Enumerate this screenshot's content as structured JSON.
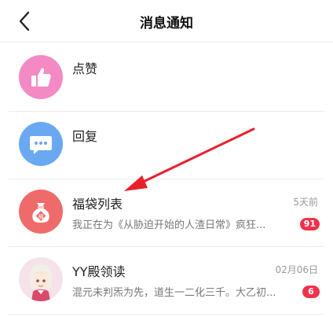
{
  "header": {
    "title": "消息通知",
    "back_icon": "chevron-left-icon"
  },
  "colors": {
    "like_avatar": "#f38ac4",
    "reply_avatar": "#6aa9f2",
    "bag_avatar": "#ef6b6b",
    "badge": "#f0324c",
    "annotation_arrow": "#e8202c"
  },
  "items": [
    {
      "title": "点赞",
      "icon": "thumbs-up-icon"
    },
    {
      "title": "回复",
      "icon": "chat-bubble-icon"
    },
    {
      "title": "福袋列表",
      "time": "5天前",
      "preview": "我正在为《从胁迫开始的人渣日常》疯狂...",
      "badge": "91",
      "icon": "lucky-bag-icon"
    },
    {
      "title": "YY殿领读",
      "time": "02月06日",
      "preview": "混元未判炁为先，道生一二化三千。大乙初...",
      "badge": "6",
      "icon": "anime-avatar"
    }
  ]
}
